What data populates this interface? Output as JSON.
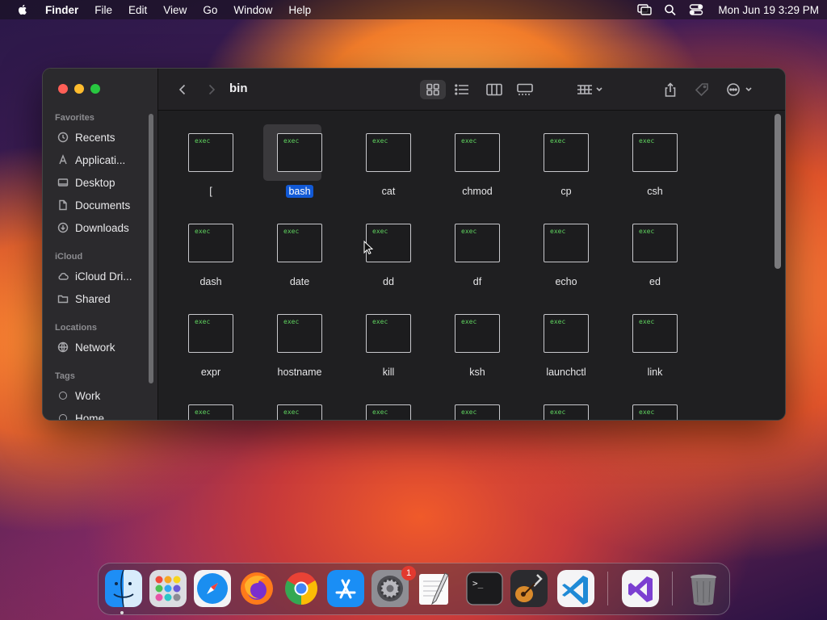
{
  "menubar": {
    "app": "Finder",
    "menus": [
      "File",
      "Edit",
      "View",
      "Go",
      "Window",
      "Help"
    ],
    "clock": "Mon Jun 19  3:29 PM"
  },
  "window": {
    "title": "bin",
    "sidebar": {
      "favorites_label": "Favorites",
      "favorites": [
        "Recents",
        "Applicati...",
        "Desktop",
        "Documents",
        "Downloads"
      ],
      "icloud_label": "iCloud",
      "icloud": [
        "iCloud Dri...",
        "Shared"
      ],
      "locations_label": "Locations",
      "locations": [
        "Network"
      ],
      "tags_label": "Tags",
      "tags": [
        "Work",
        "Home"
      ]
    },
    "files": [
      {
        "name": "[",
        "badge": "exec"
      },
      {
        "name": "bash",
        "badge": "exec",
        "selected": true
      },
      {
        "name": "cat",
        "badge": "exec"
      },
      {
        "name": "chmod",
        "badge": "exec"
      },
      {
        "name": "cp",
        "badge": "exec"
      },
      {
        "name": "csh",
        "badge": "exec"
      },
      {
        "name": "dash",
        "badge": "exec"
      },
      {
        "name": "date",
        "badge": "exec"
      },
      {
        "name": "dd",
        "badge": "exec"
      },
      {
        "name": "df",
        "badge": "exec"
      },
      {
        "name": "echo",
        "badge": "exec"
      },
      {
        "name": "ed",
        "badge": "exec"
      },
      {
        "name": "expr",
        "badge": "exec"
      },
      {
        "name": "hostname",
        "badge": "exec"
      },
      {
        "name": "kill",
        "badge": "exec"
      },
      {
        "name": "ksh",
        "badge": "exec"
      },
      {
        "name": "launchctl",
        "badge": "exec"
      },
      {
        "name": "link",
        "badge": "exec"
      },
      {
        "name": "",
        "badge": "exec"
      },
      {
        "name": "",
        "badge": "exec"
      },
      {
        "name": "",
        "badge": "exec"
      },
      {
        "name": "",
        "badge": "exec"
      },
      {
        "name": "",
        "badge": "exec"
      },
      {
        "name": "",
        "badge": "exec"
      }
    ]
  },
  "dock": {
    "system_settings_badge": "1",
    "terminal_prompt": ">_"
  }
}
